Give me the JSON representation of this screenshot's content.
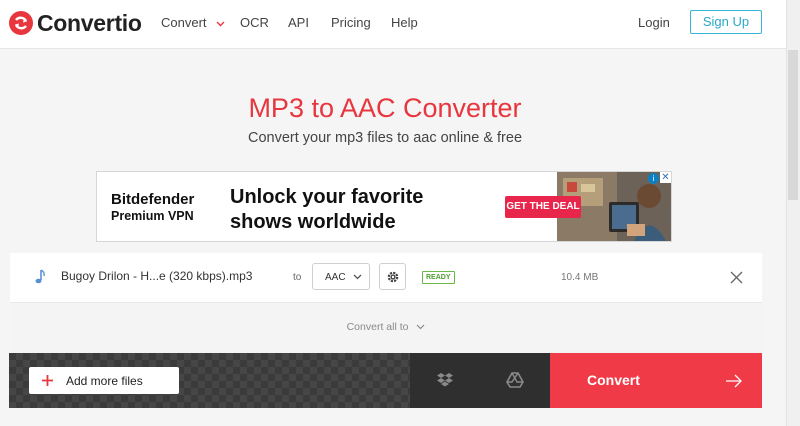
{
  "header": {
    "brand": "Convertio",
    "nav": [
      {
        "label": "Convert",
        "has_caret": true
      },
      {
        "label": "OCR"
      },
      {
        "label": "API"
      },
      {
        "label": "Pricing"
      },
      {
        "label": "Help"
      }
    ],
    "login_label": "Login",
    "signup_label": "Sign Up"
  },
  "hero": {
    "title": "MP3 to AAC Converter",
    "subtitle": "Convert your mp3 files to aac online & free"
  },
  "ad": {
    "brand_line1": "Bitdefender",
    "brand_line2": "Premium VPN",
    "headline": "Unlock your favorite shows worldwide",
    "cta": "GET THE DEAL",
    "info_icon": "info-icon",
    "close_icon": "close-icon"
  },
  "file": {
    "name": "Bugoy Drilon - H...e (320 kbps).mp3",
    "to_label": "to",
    "format": "AAC",
    "status": "READY",
    "size": "10.4 MB"
  },
  "convert_all_label": "Convert all to",
  "actions": {
    "add_more_label": "Add more files",
    "convert_label": "Convert"
  },
  "colors": {
    "accent_red": "#e8363f",
    "signup_teal": "#29a8c8",
    "ready_green": "#4fa034",
    "convert_bg": "#f03a48"
  }
}
